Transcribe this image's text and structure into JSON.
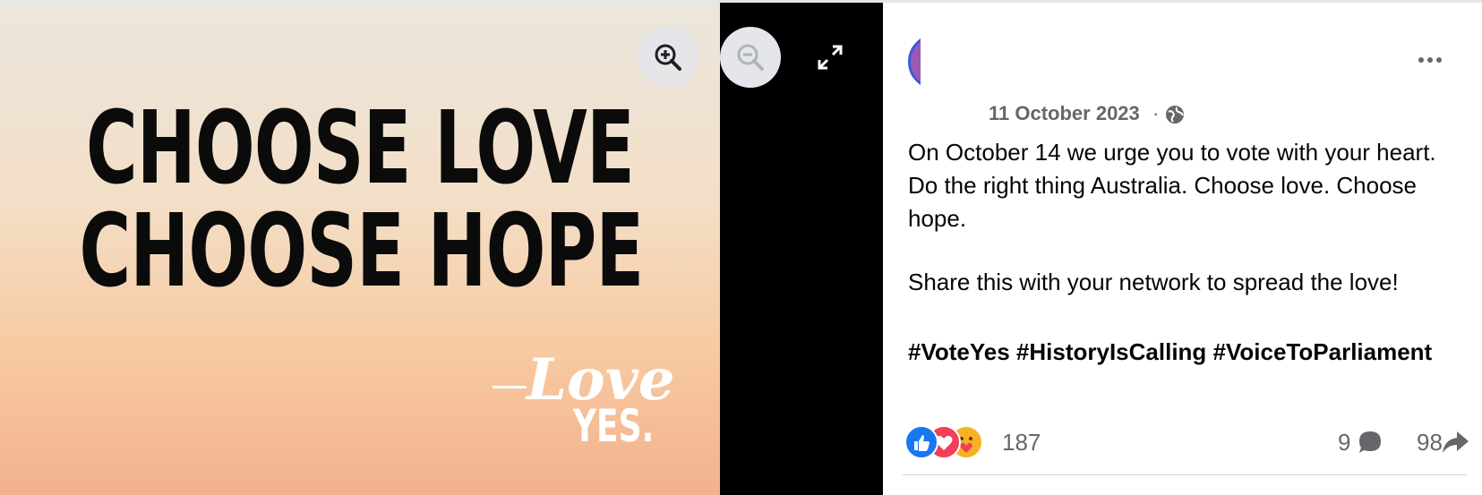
{
  "viewer": {
    "headline_line1": "CHOOSE LOVE",
    "headline_line2": "CHOOSE HOPE",
    "logo_love": "Love",
    "logo_yes": "YES.",
    "controls": [
      "zoom-in",
      "zoom-out",
      "fullscreen"
    ]
  },
  "post": {
    "date": "11 October 2023",
    "date_separator": "·",
    "audience_icon": "globe-icon",
    "paragraph1": "On October 14 we urge you to vote with your heart. Do the right thing Australia. Choose love. Choose hope.",
    "paragraph2": "Share this with your network to spread the love!",
    "hashtags": "#VoteYes #HistoryIsCalling #VoiceToParliament",
    "reaction_count": "187",
    "comment_count": "9",
    "share_count": "98"
  },
  "colors": {
    "accent_blue": "#1877f2",
    "love_red": "#f33e58",
    "care_yellow": "#f7b125",
    "muted_text": "#65676b"
  }
}
